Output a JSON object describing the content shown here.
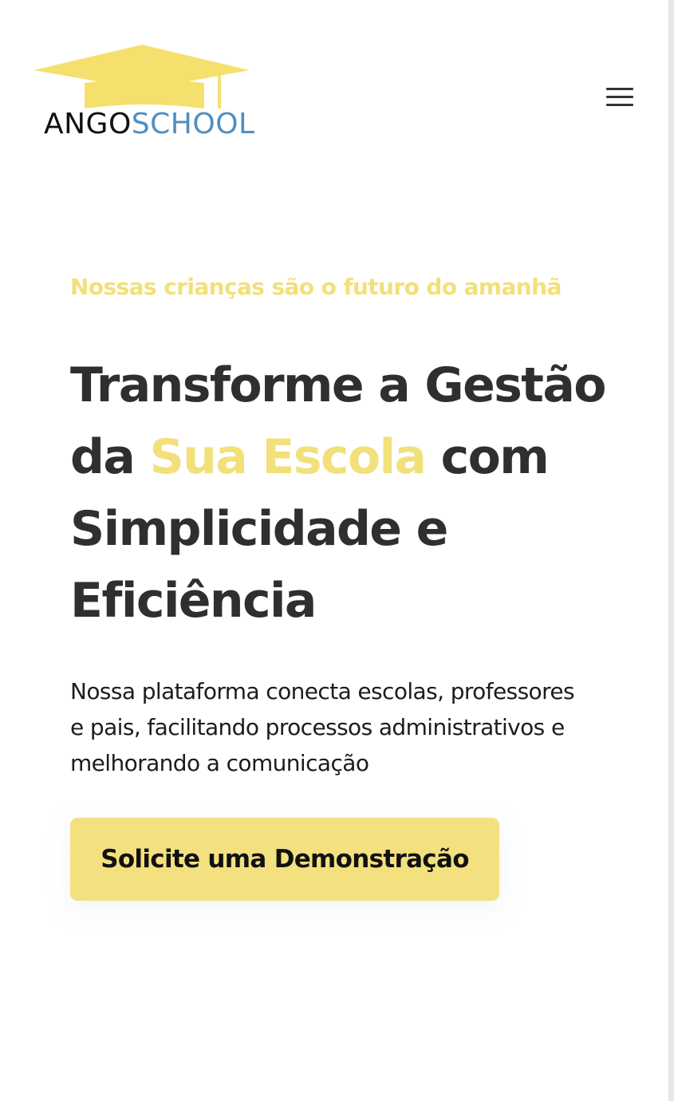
{
  "header": {
    "logo": {
      "part1": "ANGO",
      "part2": "SCHOOL",
      "icon": "graduation-cap-icon"
    },
    "menu": {
      "icon": "hamburger-menu-icon"
    }
  },
  "hero": {
    "tagline": "Nossas crianças são o futuro do amanhã",
    "headline": {
      "before": "Transforme a Gestão da ",
      "highlight": "Sua Escola",
      "after": " com Simplicidade e Eficiência"
    },
    "description": "Nossa plataforma conecta escolas, professores e pais, facilitando processos administrativos e melhorando a comunicação",
    "cta_label": "Solicite uma Demonstração"
  },
  "colors": {
    "accent_yellow": "#f2e07a",
    "button_yellow": "#f3e17f",
    "logo_blue": "#4f8fc4",
    "heading_dark": "#2f2f2f"
  }
}
